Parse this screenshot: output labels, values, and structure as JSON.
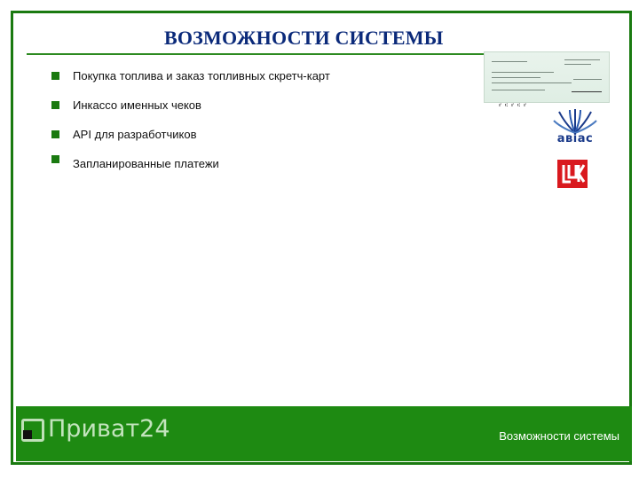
{
  "slide": {
    "title": "ВОЗМОЖНОСТИ СИСТЕМЫ",
    "bullets": [
      "Покупка топлива и заказ топливных скретч-карт",
      "Инкассо именных чеков",
      "API для разработчиков",
      "Запланированные платежи"
    ]
  },
  "images": {
    "cheque": "cheque-image",
    "avias": {
      "icon": "avias-logo-icon",
      "text": "авіас"
    },
    "lukoil": {
      "icon": "lukoil-logo-icon",
      "text": "ЛУК"
    }
  },
  "footer": {
    "logo_text": "Приват24",
    "caption": "Возможности системы"
  },
  "colors": {
    "green": "#1e8a12",
    "title_blue": "#0b2a7a",
    "lukoil_red": "#d9191e"
  }
}
